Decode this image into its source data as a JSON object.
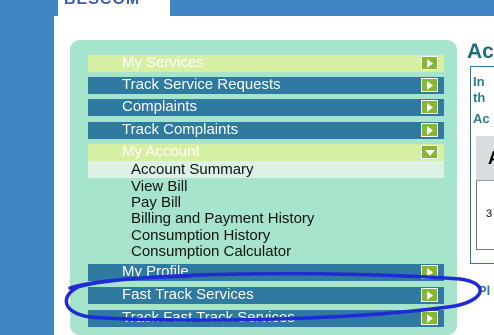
{
  "logo": {
    "text": "BESCOM"
  },
  "menu": {
    "items": [
      {
        "label": "My Services",
        "style": "light"
      },
      {
        "label": "Track Service Requests",
        "style": "dark"
      },
      {
        "label": "Complaints",
        "style": "dark"
      },
      {
        "label": "Track Complaints",
        "style": "dark"
      },
      {
        "label": "My Account",
        "style": "light",
        "expanded": true
      }
    ],
    "submenu": [
      "Account Summary",
      "View Bill",
      "Pay Bill",
      "Billing and Payment History",
      "Consumption History",
      "Consumption Calculator"
    ],
    "items_after": [
      {
        "label": "My Profile",
        "style": "dark"
      },
      {
        "label": "Fast Track Services",
        "style": "dark"
      },
      {
        "label": "Track Fast Track Services",
        "style": "dark"
      }
    ]
  },
  "content": {
    "title": "Ac",
    "line1": "In",
    "line2": "th",
    "line3": "Ac",
    "table_header": "A",
    "table_value": "3",
    "bottom_text": "Pl"
  },
  "colors": {
    "background": "#3f86c5",
    "menu_dark": "#2e7aa0",
    "menu_light": "#d6efa2",
    "panel": "#a6e4cc",
    "arrow_button": "#83b92e",
    "annotation": "#1f2bd6"
  }
}
